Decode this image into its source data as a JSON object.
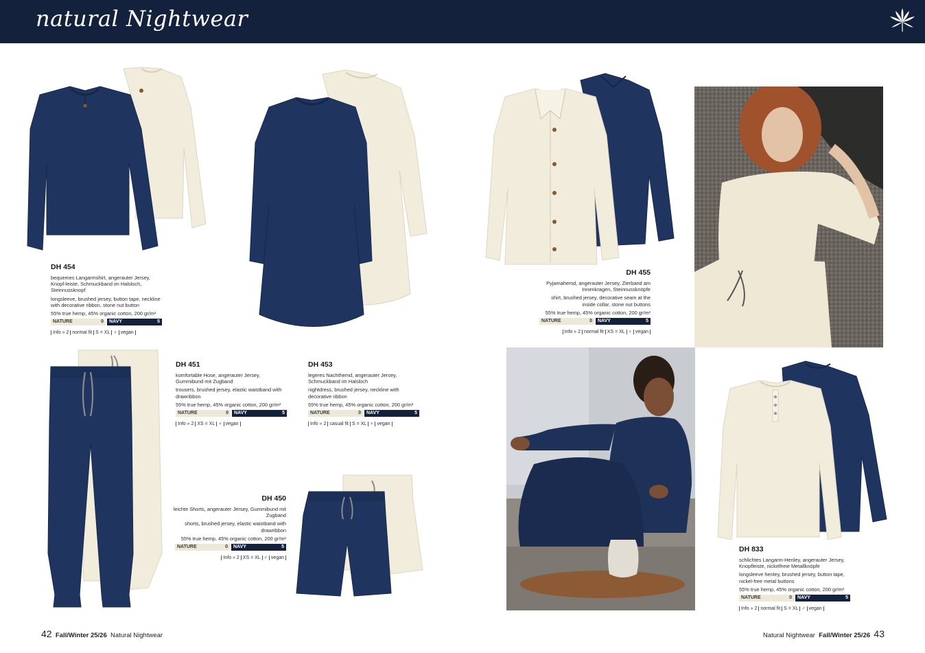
{
  "header": {
    "title": "natural Nightwear"
  },
  "colors": {
    "header_bg": "#13213d",
    "navy": "#1e3461",
    "nature": "#ede8d7"
  },
  "products": {
    "dh454": {
      "code": "DH 454",
      "desc_de": "bequemes Langarmshirt, angerauter Jersey, Knopf-leiste, Schmuckband im Halsloch, Steinnussknopf",
      "desc_en": "longsleeve, brushed jersey, button tape, neckline with decorative ribbon, stone nut button",
      "composition": "55% true hemp, 45% organic cotton, 200 gr/m²",
      "nature_label": "NATURE",
      "nature_num": "0",
      "navy_label": "NAVY",
      "navy_num": "5",
      "info": "Info » 2",
      "fit": "normal fit",
      "size": "S = XL",
      "gender": "♀",
      "vegan": "vegan"
    },
    "dh455": {
      "code": "DH 455",
      "desc_de": "Pyjamahemd, angerauter Jersey, Zierband am Innenkragen, Steinnussknöpfe",
      "desc_en": "shirt, brushed jersey, decorative seam at the inside collar, stone nut buttons",
      "composition": "55% true hemp, 45% organic cotton, 200 gr/m²",
      "nature_label": "NATURE",
      "nature_num": "0",
      "navy_label": "NAVY",
      "navy_num": "5",
      "info": "Info » 2",
      "fit": "normal fit",
      "size": "XS = XL",
      "gender": "♀",
      "vegan": "vegan"
    },
    "dh451": {
      "code": "DH 451",
      "desc_de": "komfortable Hose, angerauter Jersey, Gummibund mit Zugband",
      "desc_en": "trousers, brushed jersey, elastic waistband with drawribbon",
      "composition": "55% true hemp, 45% organic cotton, 200 gr/m²",
      "nature_label": "NATURE",
      "nature_num": "0",
      "navy_label": "NAVY",
      "navy_num": "5",
      "info": "Info » 2",
      "size": "XS = XL",
      "gender": "♀",
      "vegan": "vegan"
    },
    "dh453": {
      "code": "DH 453",
      "desc_de": "legeres Nachthemd, angerauter Jersey, Schmuckband im Halsloch",
      "desc_en": "nightdress, brushed jersey, neckline with decorative ribbon",
      "composition": "55% true hemp, 45% organic cotton, 200 gr/m²",
      "nature_label": "NATURE",
      "nature_num": "0",
      "navy_label": "NAVY",
      "navy_num": "5",
      "info": "Info » 2",
      "fit": "casual fit",
      "size": "S = XL",
      "gender": "♀",
      "vegan": "vegan"
    },
    "dh450": {
      "code": "DH 450",
      "desc_de": "leichte Shorts, angerauter Jersey, Gummibund mit Zugband",
      "desc_en": "shorts, brushed jersey, elastic waistband with drawribbon",
      "composition": "55% true hemp, 45% organic cotton, 200 gr/m²",
      "nature_label": "NATURE",
      "nature_num": "0",
      "navy_label": "NAVY",
      "navy_num": "5",
      "info": "Info » 2",
      "size": "XS = XL",
      "gender": "♂",
      "vegan": "vegan"
    },
    "dh833": {
      "code": "DH 833",
      "desc_de": "schlichtes Langarm-Henley, angerauter Jersey, Knopfleiste, nickelfreie Metallknöpfe",
      "desc_en": "longsleeve henley, brushed jersey, button tape, nickel-free metal buttons",
      "composition": "55% true hemp, 45% organic cotton, 200 gr/m²",
      "nature_label": "NATURE",
      "nature_num": "0",
      "navy_label": "NAVY",
      "navy_num": "5",
      "info": "Info » 2",
      "fit": "normal fit",
      "size": "S = XL",
      "gender": "♂",
      "vegan": "vegan"
    }
  },
  "footer": {
    "left_page": "42",
    "left_season": "Fall/Winter 25/26",
    "left_section": "Natural Nightwear",
    "right_section": "Natural Nightwear",
    "right_season": "Fall/Winter 25/26",
    "right_page": "43"
  }
}
